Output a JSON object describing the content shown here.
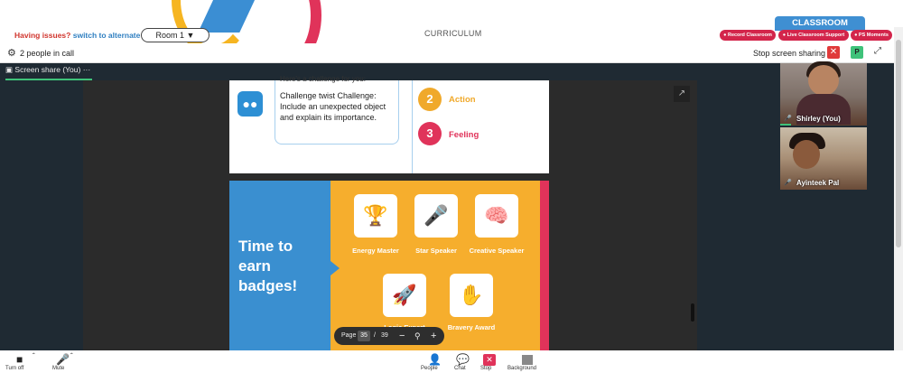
{
  "header": {
    "issues_text": "Having issues?",
    "alternate_link": "switch to alternate room",
    "room_select": "Room 1",
    "curriculum": "CURRICULUM",
    "classroom_tab": "CLASSROOM",
    "record_btn": "Record Classroom",
    "support_btn": "Live Classroom Support",
    "moments_btn": "PS Moments"
  },
  "callbar": {
    "people": "2 people in call",
    "stop_sharing": "Stop screen sharing",
    "close": "✕",
    "participant_initial": "P"
  },
  "share_tab": {
    "label": "Screen share (You)",
    "menu": "···"
  },
  "slide1": {
    "top_text": "Here's a challenge for you:",
    "challenge": "Challenge twist Challenge: Include an unexpected object and explain its importance.",
    "item2_num": "2",
    "item2_label": "Action",
    "item3_num": "3",
    "item3_label": "Feeling"
  },
  "slide2": {
    "heading": "Time to earn badges!",
    "badges": [
      {
        "label": "Energy Master",
        "icon": "trophy-icon"
      },
      {
        "label": "Star Speaker",
        "icon": "microphone-icon"
      },
      {
        "label": "Creative Speaker",
        "icon": "brain-icon"
      },
      {
        "label": "Logic Expert",
        "icon": "rocket-icon"
      },
      {
        "label": "Bravery Award",
        "icon": "hand-icon"
      }
    ]
  },
  "pager": {
    "label": "Page",
    "current": "35",
    "separator": "/",
    "total": "39"
  },
  "participants": [
    {
      "name": "Shirley (You)"
    },
    {
      "name": "Ayinteek Pal"
    }
  ],
  "toolbar": {
    "video_label": "Turn off",
    "mic_label": "Mute",
    "people_label": "People",
    "chat_label": "Chat",
    "share_label": "Stop",
    "board_label": "Background"
  },
  "colors": {
    "accent_red": "#e0335a",
    "accent_blue": "#3a8fd0",
    "accent_orange": "#f6ae2d",
    "accent_green": "#3fc27a"
  }
}
